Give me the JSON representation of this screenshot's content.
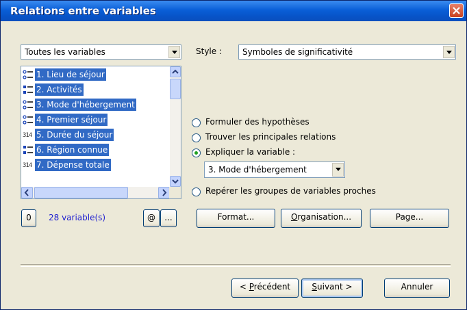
{
  "window": {
    "title": "Relations entre variables"
  },
  "var_filter": {
    "value": "Toutes les variables"
  },
  "style": {
    "label": "Style :",
    "value": "Symboles de significativité"
  },
  "variables": [
    {
      "label": "1. Lieu de séjour",
      "icon": "nominal-icon"
    },
    {
      "label": "2. Activités",
      "icon": "multiple-icon"
    },
    {
      "label": "3. Mode d'hébergement",
      "icon": "nominal-icon"
    },
    {
      "label": "4. Premier séjour",
      "icon": "nominal-icon"
    },
    {
      "label": "5. Durée du séjour",
      "icon": "numeric-icon"
    },
    {
      "label": "6. Région connue",
      "icon": "multiple-icon"
    },
    {
      "label": "7. Dépense totale",
      "icon": "numeric-icon"
    }
  ],
  "counter": {
    "zero": "0",
    "count_text": "28 variable(s)",
    "at": "@",
    "more": "..."
  },
  "options": {
    "o1": "Formuler des hypothèses",
    "o2": "Trouver les principales relations",
    "o3": "Expliquer la variable :",
    "o4": "Repérer les groupes de variables proches",
    "selected": "o3"
  },
  "explain_var": {
    "value": "3. Mode d'hébergement"
  },
  "buttons": {
    "format": "Format...",
    "organisation_u": "O",
    "organisation_rest": "rganisation...",
    "page": "Page...",
    "prev_prefix": "< ",
    "prev_u": "P",
    "prev_rest": "récédent",
    "next_u": "S",
    "next_rest": "uivant >",
    "cancel": "Annuler"
  },
  "colors": {
    "title_bar": "#0a5fd8",
    "selection": "#316ac5",
    "count_text": "#1f1fd0"
  }
}
